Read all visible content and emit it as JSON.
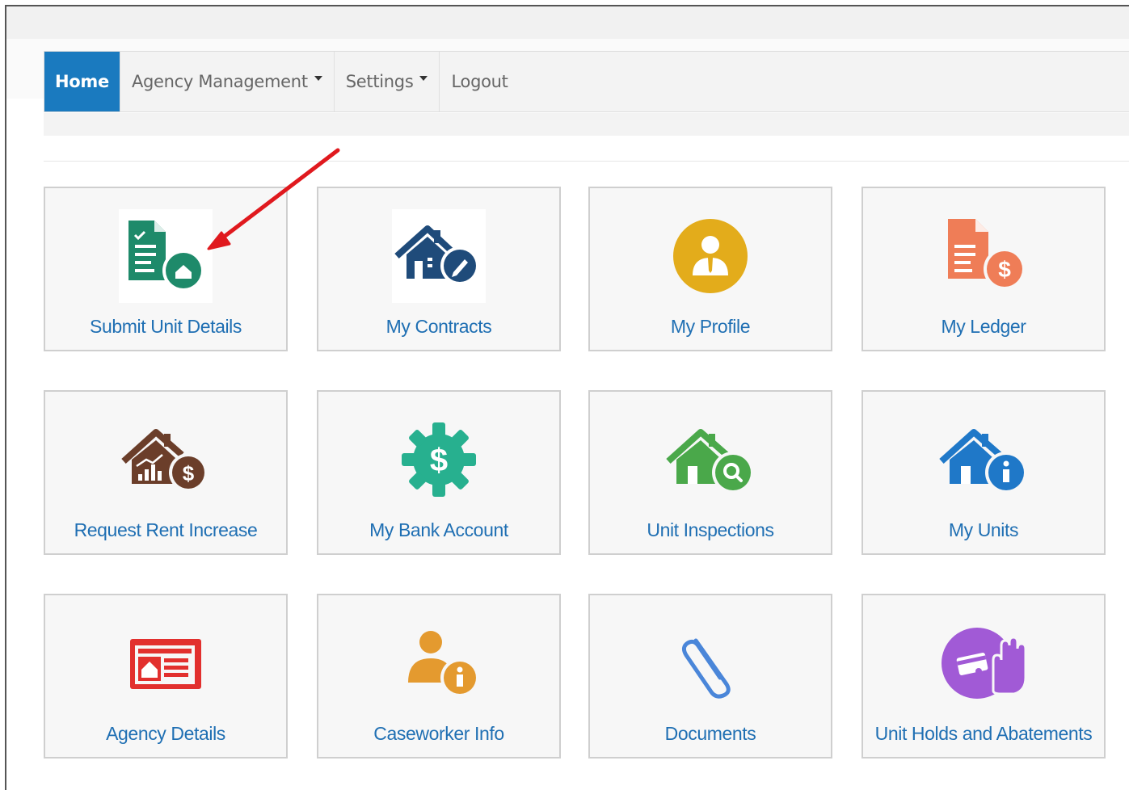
{
  "nav": {
    "home": "Home",
    "agency_management": "Agency Management",
    "settings": "Settings",
    "logout": "Logout"
  },
  "tiles": [
    {
      "label": "Submit Unit Details",
      "icon": "submit-unit-details-icon"
    },
    {
      "label": "My Contracts",
      "icon": "contracts-house-icon"
    },
    {
      "label": "My Profile",
      "icon": "profile-person-icon"
    },
    {
      "label": "My Ledger",
      "icon": "ledger-dollar-icon"
    },
    {
      "label": "Request Rent Increase",
      "icon": "rent-increase-house-icon"
    },
    {
      "label": "My Bank Account",
      "icon": "bank-gear-dollar-icon"
    },
    {
      "label": "Unit Inspections",
      "icon": "inspection-house-search-icon"
    },
    {
      "label": "My Units",
      "icon": "units-house-info-icon"
    },
    {
      "label": "Agency Details",
      "icon": "agency-newspaper-icon"
    },
    {
      "label": "Caseworker Info",
      "icon": "caseworker-info-icon"
    },
    {
      "label": "Documents",
      "icon": "paperclip-icon"
    },
    {
      "label": "Unit Holds and Abatements",
      "icon": "holds-hand-card-icon"
    }
  ],
  "colors": {
    "nav_active": "#1a7abf",
    "tile_label": "#1f6fb3",
    "annotation_arrow": "#e0191e"
  }
}
